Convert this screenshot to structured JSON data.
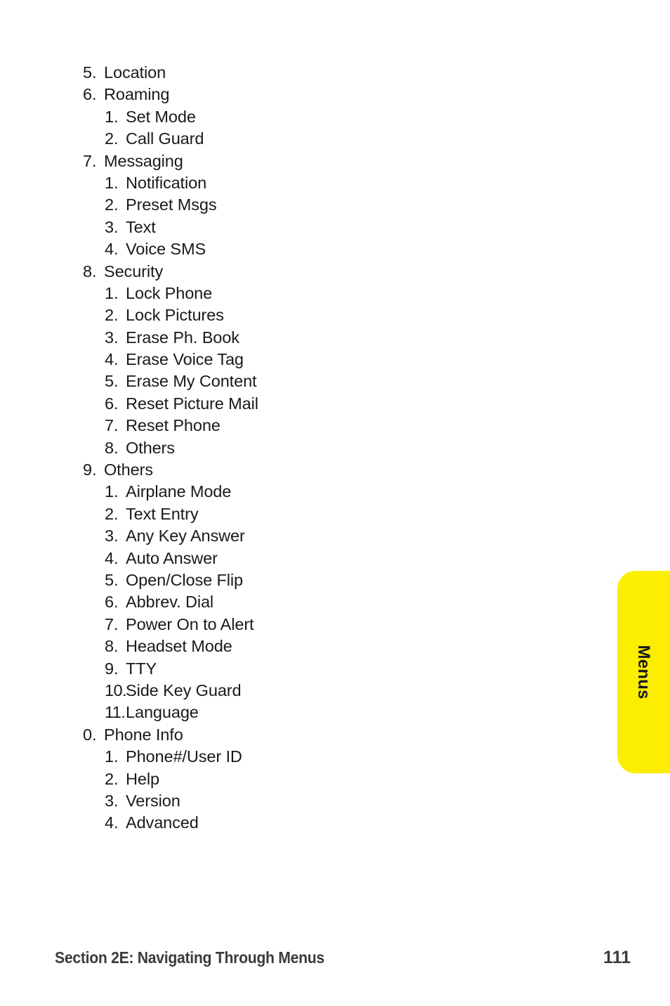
{
  "page": {
    "background_color": "#ffffff",
    "text_color": "#1a1a1a"
  },
  "outline": {
    "items": [
      {
        "level": 1,
        "number": "5.",
        "label": "Location"
      },
      {
        "level": 1,
        "number": "6.",
        "label": "Roaming"
      },
      {
        "level": 2,
        "number": "1.",
        "label": "Set Mode"
      },
      {
        "level": 2,
        "number": "2.",
        "label": "Call Guard"
      },
      {
        "level": 1,
        "number": "7.",
        "label": "Messaging"
      },
      {
        "level": 2,
        "number": "1.",
        "label": "Notification"
      },
      {
        "level": 2,
        "number": "2.",
        "label": "Preset Msgs"
      },
      {
        "level": 2,
        "number": "3.",
        "label": "Text"
      },
      {
        "level": 2,
        "number": "4.",
        "label": "Voice SMS"
      },
      {
        "level": 1,
        "number": "8.",
        "label": "Security"
      },
      {
        "level": 2,
        "number": "1.",
        "label": "Lock Phone"
      },
      {
        "level": 2,
        "number": "2.",
        "label": "Lock Pictures"
      },
      {
        "level": 2,
        "number": "3.",
        "label": "Erase Ph. Book"
      },
      {
        "level": 2,
        "number": "4.",
        "label": "Erase Voice Tag"
      },
      {
        "level": 2,
        "number": "5.",
        "label": "Erase My Content"
      },
      {
        "level": 2,
        "number": "6.",
        "label": "Reset Picture Mail"
      },
      {
        "level": 2,
        "number": "7.",
        "label": "Reset Phone"
      },
      {
        "level": 2,
        "number": "8.",
        "label": "Others"
      },
      {
        "level": 1,
        "number": "9.",
        "label": "Others"
      },
      {
        "level": 2,
        "number": "1.",
        "label": "Airplane Mode"
      },
      {
        "level": 2,
        "number": "2.",
        "label": "Text Entry"
      },
      {
        "level": 2,
        "number": "3.",
        "label": "Any Key Answer"
      },
      {
        "level": 2,
        "number": "4.",
        "label": "Auto Answer"
      },
      {
        "level": 2,
        "number": "5.",
        "label": "Open/Close Flip"
      },
      {
        "level": 2,
        "number": "6.",
        "label": "Abbrev. Dial"
      },
      {
        "level": 2,
        "number": "7.",
        "label": "Power On to Alert"
      },
      {
        "level": 2,
        "number": "8.",
        "label": "Headset Mode"
      },
      {
        "level": 2,
        "number": "9.",
        "label": "TTY"
      },
      {
        "level": 2,
        "number": "10.",
        "label": "Side Key Guard"
      },
      {
        "level": 2,
        "number": "11.",
        "label": "Language"
      },
      {
        "level": 1,
        "number": "0.",
        "label": "Phone Info"
      },
      {
        "level": 2,
        "number": "1.",
        "label": "Phone#/User ID"
      },
      {
        "level": 2,
        "number": "2.",
        "label": "Help"
      },
      {
        "level": 2,
        "number": "3.",
        "label": "Version"
      },
      {
        "level": 2,
        "number": "4.",
        "label": "Advanced"
      }
    ]
  },
  "side_tab": {
    "label": "Menus",
    "color": "#fcee00",
    "text_color": "#1a1a1a"
  },
  "footer": {
    "title": "Section 2E: Navigating Through Menus",
    "page_number": "111",
    "text_color": "#3b3b3b"
  }
}
